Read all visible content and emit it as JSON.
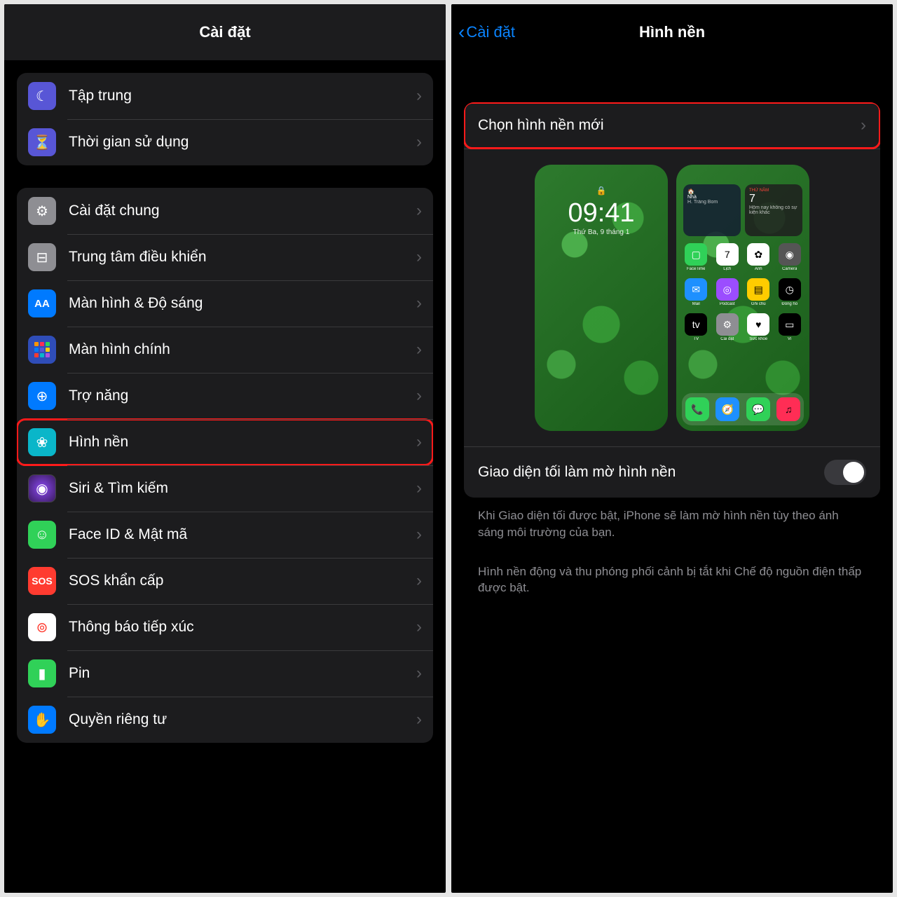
{
  "left": {
    "title": "Cài đặt",
    "group1": [
      {
        "label": "Tập trung",
        "icon": "moon-icon",
        "iconText": "☾",
        "cls": "ic-focus"
      },
      {
        "label": "Thời gian sử dụng",
        "icon": "hourglass-icon",
        "iconText": "⏳",
        "cls": "ic-screentime"
      }
    ],
    "group2": [
      {
        "label": "Cài đặt chung",
        "icon": "gear-icon",
        "iconText": "⚙",
        "cls": "ic-general"
      },
      {
        "label": "Trung tâm điều khiển",
        "icon": "toggles-icon",
        "iconText": "⊟",
        "cls": "ic-control"
      },
      {
        "label": "Màn hình & Độ sáng",
        "icon": "display-icon",
        "iconText": "AA",
        "cls": "ic-display"
      },
      {
        "label": "Màn hình chính",
        "icon": "home-grid-icon",
        "iconText": "",
        "cls": "ic-home"
      },
      {
        "label": "Trợ năng",
        "icon": "accessibility-icon",
        "iconText": "⊕",
        "cls": "ic-access"
      },
      {
        "label": "Hình nền",
        "icon": "wallpaper-icon",
        "iconText": "❀",
        "cls": "ic-wallpaper",
        "highlight": true
      },
      {
        "label": "Siri & Tìm kiếm",
        "icon": "siri-icon",
        "iconText": "◉",
        "cls": "siri-grad"
      },
      {
        "label": "Face ID & Mật mã",
        "icon": "faceid-icon",
        "iconText": "☺",
        "cls": "ic-faceid"
      },
      {
        "label": "SOS khẩn cấp",
        "icon": "sos-icon",
        "iconText": "SOS",
        "cls": "ic-sos"
      },
      {
        "label": "Thông báo tiếp xúc",
        "icon": "exposure-icon",
        "iconText": "⊚",
        "cls": "ic-exposure"
      },
      {
        "label": "Pin",
        "icon": "battery-icon",
        "iconText": "▮",
        "cls": "ic-battery"
      },
      {
        "label": "Quyền riêng tư",
        "icon": "privacy-icon",
        "iconText": "✋",
        "cls": "ic-privacy"
      }
    ]
  },
  "right": {
    "backLabel": "Cài đặt",
    "title": "Hình nền",
    "chooseLabel": "Chọn hình nền mới",
    "lockPreview": {
      "time": "09:41",
      "date": "Thứ Ba, 9 tháng 1"
    },
    "homePreview": {
      "widget1": {
        "title": "Nhà",
        "sub": "H. Trảng Bom"
      },
      "widget2": {
        "dow": "THỨ NĂM",
        "day": "7",
        "note": "Hôm nay không có sự kiện khác"
      },
      "apps": [
        {
          "lbl": "FaceTime",
          "bg": "#30d158",
          "t": "▢"
        },
        {
          "lbl": "Lịch",
          "bg": "#fff",
          "t": "7"
        },
        {
          "lbl": "Ảnh",
          "bg": "#fff",
          "t": "✿"
        },
        {
          "lbl": "Camera",
          "bg": "#555",
          "t": "◉"
        },
        {
          "lbl": "Mail",
          "bg": "#1e90ff",
          "t": "✉"
        },
        {
          "lbl": "Podcast",
          "bg": "#9b4dff",
          "t": "◎"
        },
        {
          "lbl": "Ghi chú",
          "bg": "#ffcc00",
          "t": "▤"
        },
        {
          "lbl": "Đồng hồ",
          "bg": "#000",
          "t": "◷"
        },
        {
          "lbl": "TV",
          "bg": "#000",
          "t": "tv"
        },
        {
          "lbl": "Cài đặt",
          "bg": "#8e8e93",
          "t": "⚙"
        },
        {
          "lbl": "Sức khỏe",
          "bg": "#fff",
          "t": "♥"
        },
        {
          "lbl": "Ví",
          "bg": "#000",
          "t": "▭"
        }
      ],
      "dock": [
        {
          "bg": "#30d158",
          "t": "📞"
        },
        {
          "bg": "#1e90ff",
          "t": "🧭"
        },
        {
          "bg": "#30d158",
          "t": "💬"
        },
        {
          "bg": "#ff2d55",
          "t": "♫"
        }
      ]
    },
    "dimLabel": "Giao diện tối làm mờ hình nền",
    "dimSwitch": true,
    "note1": "Khi Giao diện tối được bật, iPhone sẽ làm mờ hình nền tùy theo ánh sáng môi trường của bạn.",
    "note2": "Hình nền động và thu phóng phối cảnh bị tắt khi Chế độ nguồn điện thấp được bật."
  }
}
